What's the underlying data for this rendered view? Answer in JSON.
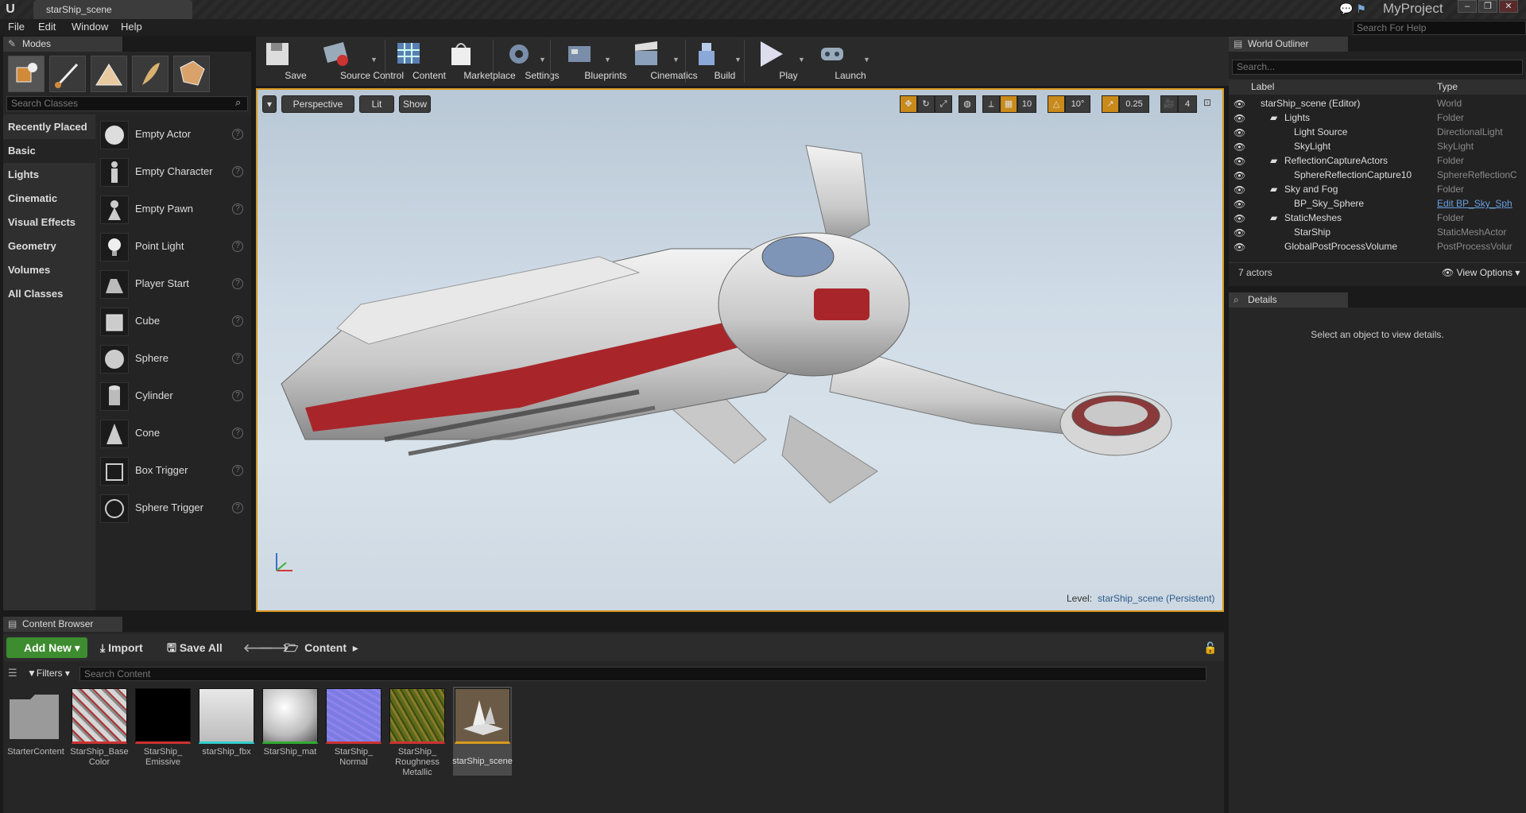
{
  "titlebar": {
    "logo": "U",
    "document_tab": "starShip_scene",
    "project": "MyProject"
  },
  "menu": {
    "items": [
      "File",
      "Edit",
      "Window",
      "Help"
    ],
    "help_search_placeholder": "Search For Help"
  },
  "modes": {
    "tab": "Modes",
    "search_placeholder": "Search Classes",
    "categories": [
      "Recently Placed",
      "Basic",
      "Lights",
      "Cinematic",
      "Visual Effects",
      "Geometry",
      "Volumes",
      "All Classes"
    ],
    "selected_category": "Basic",
    "actors": [
      "Empty Actor",
      "Empty Character",
      "Empty Pawn",
      "Point Light",
      "Player Start",
      "Cube",
      "Sphere",
      "Cylinder",
      "Cone",
      "Box Trigger",
      "Sphere Trigger"
    ]
  },
  "toolbar": {
    "buttons": [
      "Save",
      "Source Control",
      "Content",
      "Marketplace",
      "Settings",
      "Blueprints",
      "Cinematics",
      "Build",
      "Play",
      "Launch"
    ]
  },
  "viewport": {
    "perspective": "Perspective",
    "lit": "Lit",
    "show": "Show",
    "grid_snap": "10",
    "rotation_snap": "10°",
    "scale_snap": "0.25",
    "camera_speed": "4",
    "level_label": "Level:",
    "level_name": "starShip_scene (Persistent)",
    "accent_color": "#d79a1f"
  },
  "world_outliner": {
    "tab": "World Outliner",
    "search_placeholder": "Search...",
    "col_label": "Label",
    "col_type": "Type",
    "rows": [
      {
        "label": "starShip_scene (Editor)",
        "type": "World"
      },
      {
        "label": "Lights",
        "type": "Folder"
      },
      {
        "label": "Light Source",
        "type": "DirectionalLight"
      },
      {
        "label": "SkyLight",
        "type": "SkyLight"
      },
      {
        "label": "ReflectionCaptureActors",
        "type": "Folder"
      },
      {
        "label": "SphereReflectionCapture10",
        "type": "SphereReflectionC"
      },
      {
        "label": "Sky and Fog",
        "type": "Folder"
      },
      {
        "label": "BP_Sky_Sphere",
        "type": "Edit BP_Sky_Sph"
      },
      {
        "label": "StaticMeshes",
        "type": "Folder"
      },
      {
        "label": "StarShip",
        "type": "StaticMeshActor"
      },
      {
        "label": "GlobalPostProcessVolume",
        "type": "PostProcessVolur"
      }
    ],
    "actor_count": "7 actors",
    "view_options": "View Options"
  },
  "details": {
    "tab": "Details",
    "message": "Select an object to view details."
  },
  "content_browser": {
    "tab": "Content Browser",
    "add_new": "Add New",
    "import": "Import",
    "save_all": "Save All",
    "path": "Content",
    "filters": "Filters",
    "search_placeholder": "Search Content",
    "assets": [
      {
        "name": "StarterContent"
      },
      {
        "name": "StarShip_Base Color"
      },
      {
        "name": "StarShip_ Emissive"
      },
      {
        "name": "starShip_fbx"
      },
      {
        "name": "StarShip_mat"
      },
      {
        "name": "StarShip_ Normal"
      },
      {
        "name": "StarShip_ Roughness Metallic"
      },
      {
        "name": "starShip_scene"
      }
    ]
  }
}
